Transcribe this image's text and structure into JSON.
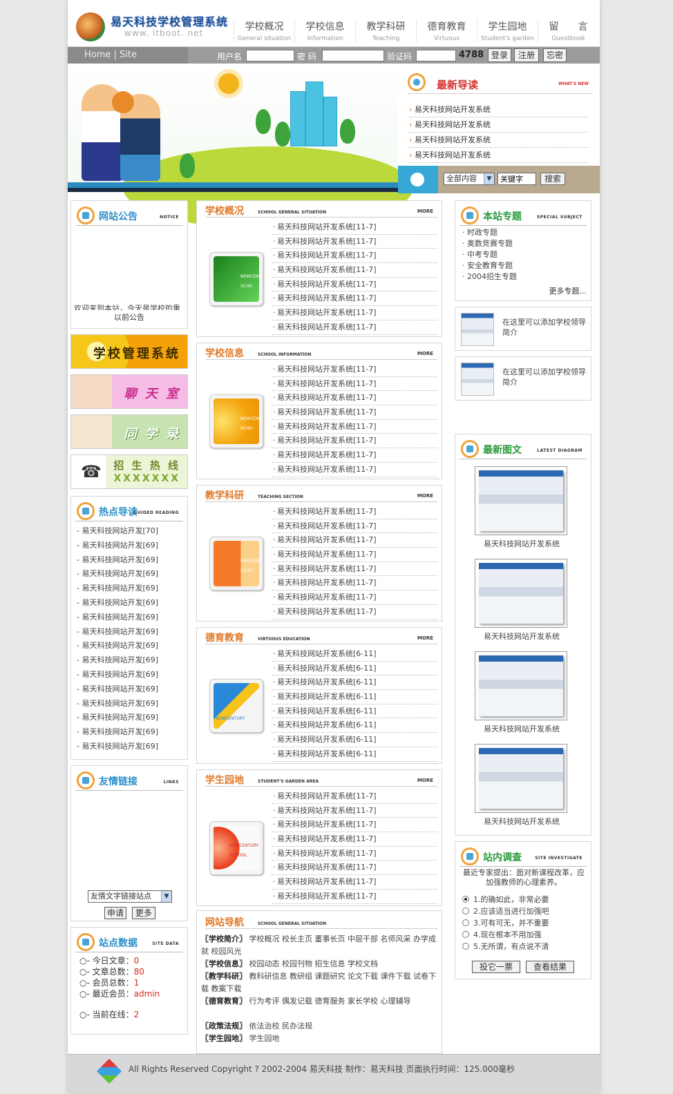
{
  "header": {
    "title": "易天科技学校管理系统",
    "url": "www. itboot. net",
    "nav": [
      {
        "cn": "学校概况",
        "en": "General situation"
      },
      {
        "cn": "学校信息",
        "en": "Information"
      },
      {
        "cn": "教学科研",
        "en": "Teaching"
      },
      {
        "cn": "德育教育",
        "en": "Virtuous"
      },
      {
        "cn": "学生园地",
        "en": "Student's garden"
      },
      {
        "cn": "留　　言",
        "en": "Guestbook"
      }
    ]
  },
  "loginbar": {
    "home": "Home | Site",
    "username_label": "用户名",
    "password_label": "密 码",
    "captcha_label": "验证码",
    "captcha_value": "4788",
    "login": "登录",
    "register": "注册",
    "forgot": "忘密"
  },
  "latest": {
    "title": "最新导读",
    "en": "WHAT'S NEW",
    "items": [
      "易天科技网站开发系统",
      "易天科技网站开发系统",
      "易天科技网站开发系统",
      "易天科技网站开发系统"
    ]
  },
  "search": {
    "scope": "全部内容",
    "keyword": "关键字",
    "button": "搜索"
  },
  "notice": {
    "title": "网站公告",
    "en": "NOTICE",
    "scroll_text": "欢迎来到本站，今天是学校的重要",
    "past": "以前公告"
  },
  "left_banners": [
    "学校管理系统",
    "聊 天 室",
    "同 学 录",
    "招 生 热 线"
  ],
  "hotline": "XXXXXXX",
  "hot": {
    "title": "热点导读",
    "en": "GUIDED READING",
    "items": [
      "- 易天科技网站开发[70]",
      "- 易天科技网站开发[69]",
      "- 易天科技网站开发[69]",
      "- 易天科技网站开发[69]",
      "- 易天科技网站开发[69]",
      "- 易天科技网站开发[69]",
      "- 易天科技网站开发[69]",
      "- 易天科技网站开发[69]",
      "- 易天科技网站开发[69]",
      "- 易天科技网站开发[69]",
      "- 易天科技网站开发[69]",
      "- 易天科技网站开发[69]",
      "- 易天科技网站开发[69]",
      "- 易天科技网站开发[69]",
      "- 易天科技网站开发[69]",
      "- 易天科技网站开发[69]"
    ]
  },
  "links": {
    "title": "友情链接",
    "en": "LINKS",
    "select": "友情文字链接站点",
    "apply": "申请",
    "more": "更多"
  },
  "stats": {
    "title": "站点数据",
    "en": "SITE DATA",
    "today_label": "○- 今日文章：",
    "today": "0",
    "total_label": "○- 文章总数：",
    "total": "80",
    "members_label": "○- 会员总数：",
    "members": "1",
    "latest_label": "○- 最近会员：",
    "latest": "admin",
    "online_label": "○- 当前在线：",
    "online": "2"
  },
  "sections": [
    {
      "title": "学校概况",
      "en": "SCHOOL GENERAL SITUATION",
      "items": [
        "易天科技网站开发系统[11-7]",
        "易天科技网站开发系统[11-7]",
        "易天科技网站开发系统[11-7]",
        "易天科技网站开发系统[11-7]",
        "易天科技网站开发系统[11-7]",
        "易天科技网站开发系统[11-7]",
        "易天科技网站开发系统[11-7]",
        "易天科技网站开发系统[11-7]"
      ]
    },
    {
      "title": "学校信息",
      "en": "SCHOOL INFORMATION",
      "items": [
        "易天科技网站开发系统[11-7]",
        "易天科技网站开发系统[11-7]",
        "易天科技网站开发系统[11-7]",
        "易天科技网站开发系统[11-7]",
        "易天科技网站开发系统[11-7]",
        "易天科技网站开发系统[11-7]",
        "易天科技网站开发系统[11-7]",
        "易天科技网站开发系统[11-7]"
      ]
    },
    {
      "title": "教学科研",
      "en": "TEACHING SECTION",
      "items": [
        "易天科技网站开发系统[11-7]",
        "易天科技网站开发系统[11-7]",
        "易天科技网站开发系统[11-7]",
        "易天科技网站开发系统[11-7]",
        "易天科技网站开发系统[11-7]",
        "易天科技网站开发系统[11-7]",
        "易天科技网站开发系统[11-7]",
        "易天科技网站开发系统[11-7]"
      ]
    },
    {
      "title": "德育教育",
      "en": "VIRTUOUS EDUCATION",
      "items": [
        "易天科技网站开发系统[6-11]",
        "易天科技网站开发系统[6-11]",
        "易天科技网站开发系统[6-11]",
        "易天科技网站开发系统[6-11]",
        "易天科技网站开发系统[6-11]",
        "易天科技网站开发系统[6-11]",
        "易天科技网站开发系统[6-11]",
        "易天科技网站开发系统[6-11]"
      ]
    },
    {
      "title": "学生园地",
      "en": "STUDENT'S GARDEN AREA",
      "items": [
        "易天科技网站开发系统[11-7]",
        "易天科技网站开发系统[11-7]",
        "易天科技网站开发系统[11-7]",
        "易天科技网站开发系统[11-7]",
        "易天科技网站开发系统[11-7]",
        "易天科技网站开发系统[11-7]",
        "易天科技网站开发系统[11-7]",
        "易天科技网站开发系统[11-7]"
      ]
    }
  ],
  "more_label": "MORE",
  "thumb_text": "NEWCENT SCHO",
  "thumb_text_full": "NEWCENTURY SCHOOL",
  "thumb_text_short": "NEWCENTURY",
  "guide": {
    "title": "网站导航",
    "en": "SCHOOL GENERAL SITUATION",
    "rows": [
      {
        "head": "〖学校简介〗",
        "body": "学校概况 校长主页 董事长页 中层干部 名师风采 办学成就 校园风光"
      },
      {
        "head": "〖学校信息〗",
        "body": "校园动态 校园刊物 招生信息 学校文档"
      },
      {
        "head": "〖教学科研〗",
        "body": "教科研信息 教研组 课题研究 论文下载 课件下载 试卷下载 教案下载"
      },
      {
        "head": "〖德育教育〗",
        "body": "行为考评 偶发记载 德育服务 家长学校 心理辅导"
      },
      {
        "head": "〖政策法规〗",
        "body": "依法治校 民办法规"
      },
      {
        "head": "〖学生园地〗",
        "body": "学生园地"
      }
    ]
  },
  "topics": {
    "title": "本站专题",
    "en": "SPECIAL SUBJECT",
    "items": [
      "· 时政专题",
      "· 奥数竞赛专题",
      "· 中考专题",
      "· 安全教育专题",
      "· 2004招生专题"
    ],
    "more": "更多专题..."
  },
  "promo": [
    "在这里可以添加学校领导简介",
    "在这里可以添加学校领导简介"
  ],
  "gallery": {
    "title": "最新图文",
    "en": "LATEST DIAGRAM",
    "captions": [
      "易天科技网站开发系统",
      "易天科技网站开发系统",
      "易天科技网站开发系统",
      "易天科技网站开发系统"
    ]
  },
  "survey": {
    "title": "站内调查",
    "en": "SITE INVESTIGATE",
    "question": "最近专家提出：面对新课程改革，应加强教师的心理素养。",
    "options": [
      "1.的确如此，非常必要",
      "2.应该适当进行加强吧",
      "3.可有可无，并不重要",
      "4.现在根本不用加强",
      "5.无所谓，有点说不清"
    ],
    "vote": "投它一票",
    "results": "查看结果"
  },
  "footer": "All Rights Reserved Copyright ? 2002-2004 易天科技  制作：易天科技  页面执行时间：125.000毫秒",
  "colors": {
    "accent_orange": "#e07a2a",
    "accent_blue": "#2b8fc9",
    "accent_red": "#d4302a",
    "login_bar": "#9b9b9b"
  }
}
